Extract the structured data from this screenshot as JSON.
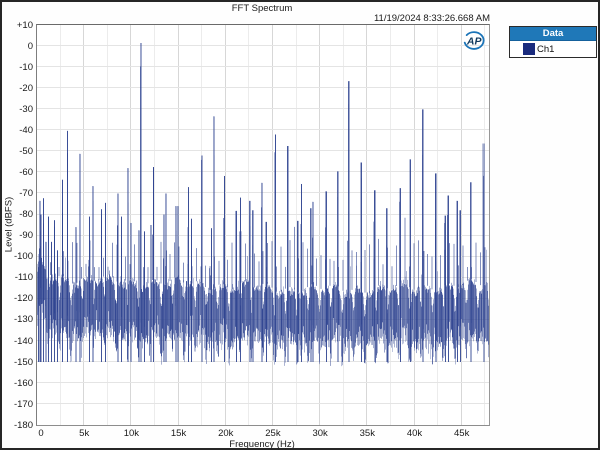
{
  "window": {
    "background": "#ffffff",
    "border_color": "#272727"
  },
  "header": {
    "title": "FFT Spectrum",
    "timestamp": "11/19/2024 8:33:26.668 AM"
  },
  "logo": {
    "text": "AP",
    "text_color": "#123a5e",
    "arc_color": "#1b74b8"
  },
  "legend": {
    "header": "Data",
    "header_bg": "#1f78b8",
    "header_text_color": "#ffffff",
    "items": [
      {
        "label": "Ch1",
        "swatch_color": "#1a2b7d"
      }
    ]
  },
  "chart_data": {
    "type": "line",
    "title": "FFT Spectrum",
    "xlabel": "Frequency (Hz)",
    "ylabel": "Level (dBFS)",
    "xlim": [
      0,
      48000
    ],
    "ylim": [
      -180,
      10
    ],
    "grid": {
      "h_step_db": 10,
      "v_minor_step_hz": 2500,
      "v_major_step_hz": 5000,
      "h_color": "#e4e4e4",
      "v_major_color": "#d7d7d7",
      "v_minor_color": "#ececec"
    },
    "x_ticks": [
      {
        "hz": 0,
        "label": "0"
      },
      {
        "hz": 5000,
        "label": "5k"
      },
      {
        "hz": 10000,
        "label": "10k"
      },
      {
        "hz": 15000,
        "label": "15k"
      },
      {
        "hz": 20000,
        "label": "20k"
      },
      {
        "hz": 25000,
        "label": "25k"
      },
      {
        "hz": 30000,
        "label": "30k"
      },
      {
        "hz": 35000,
        "label": "35k"
      },
      {
        "hz": 40000,
        "label": "40k"
      },
      {
        "hz": 45000,
        "label": "45k"
      }
    ],
    "y_ticks": [
      {
        "db": 10,
        "label": "+10"
      },
      {
        "db": 0,
        "label": "0"
      },
      {
        "db": -10,
        "label": "-10"
      },
      {
        "db": -20,
        "label": "-20"
      },
      {
        "db": -30,
        "label": "-30"
      },
      {
        "db": -40,
        "label": "-40"
      },
      {
        "db": -50,
        "label": "-50"
      },
      {
        "db": -60,
        "label": "-60"
      },
      {
        "db": -70,
        "label": "-70"
      },
      {
        "db": -80,
        "label": "-80"
      },
      {
        "db": -90,
        "label": "-90"
      },
      {
        "db": -100,
        "label": "-100"
      },
      {
        "db": -110,
        "label": "-110"
      },
      {
        "db": -120,
        "label": "-120"
      },
      {
        "db": -130,
        "label": "-130"
      },
      {
        "db": -140,
        "label": "-140"
      },
      {
        "db": -150,
        "label": "-150"
      },
      {
        "db": -160,
        "label": "-160"
      },
      {
        "db": -170,
        "label": "-170"
      },
      {
        "db": -180,
        "label": "-180"
      }
    ],
    "series": [
      {
        "name": "Ch1",
        "color": "#2e4390",
        "peaks_hz_dbfs": [
          [
            150,
            -105
          ],
          [
            300,
            -73.5
          ],
          [
            430,
            -80
          ],
          [
            680,
            -72.3
          ],
          [
            930,
            -93
          ],
          [
            1220,
            -81
          ],
          [
            1520,
            -93
          ],
          [
            1860,
            -82.7
          ],
          [
            2180,
            -97
          ],
          [
            2720,
            -63.5
          ],
          [
            3230,
            -40.3
          ],
          [
            4140,
            -86
          ],
          [
            4540,
            -51.2
          ],
          [
            5550,
            -81
          ],
          [
            5940,
            -66.5
          ],
          [
            6850,
            -77.5
          ],
          [
            7240,
            -74.5
          ],
          [
            8560,
            -70
          ],
          [
            8940,
            -81
          ],
          [
            9650,
            -58
          ],
          [
            9960,
            -84
          ],
          [
            10800,
            -87.5
          ],
          [
            11000,
            1.4
          ],
          [
            11400,
            -88
          ],
          [
            12100,
            -85
          ],
          [
            12370,
            -57.5
          ],
          [
            13450,
            -80
          ],
          [
            13670,
            -70
          ],
          [
            14750,
            -76
          ],
          [
            14960,
            -76
          ],
          [
            16050,
            -67
          ],
          [
            16390,
            -82
          ],
          [
            17470,
            -52
          ],
          [
            18500,
            -86.5
          ],
          [
            18780,
            -33.4
          ],
          [
            19890,
            -61.7
          ],
          [
            21130,
            -78.3
          ],
          [
            21570,
            -72
          ],
          [
            22560,
            -73.5
          ],
          [
            22870,
            -78
          ],
          [
            23850,
            -65
          ],
          [
            24300,
            -83.5
          ],
          [
            25280,
            -42
          ],
          [
            26580,
            -47.5
          ],
          [
            27660,
            -83
          ],
          [
            28050,
            -65.5
          ],
          [
            29010,
            -77
          ],
          [
            29270,
            -74
          ],
          [
            30650,
            -69
          ],
          [
            31900,
            -59.5
          ],
          [
            33070,
            -16.7
          ],
          [
            34400,
            -55.3
          ],
          [
            35800,
            -68.5
          ],
          [
            37100,
            -77
          ],
          [
            38500,
            -67.5
          ],
          [
            39580,
            -53.8
          ],
          [
            40920,
            -30.1
          ],
          [
            42300,
            -60.5
          ],
          [
            43270,
            -80.5
          ],
          [
            43600,
            -71
          ],
          [
            44580,
            -73.5
          ],
          [
            44900,
            -78
          ],
          [
            46000,
            -64.7
          ],
          [
            47350,
            -46.3
          ]
        ],
        "noise_floor": {
          "mean_dbfs": -120,
          "sigma_db": 4.34,
          "lowfreq_boost_db": 13,
          "lowfreq_corner_hz": 1100,
          "scallop_period_hz": 1200,
          "scallop_depth_db": 10,
          "comb_spacing_hz": 470,
          "floor_min_dbfs": -153,
          "seed": 1337
        }
      }
    ]
  }
}
